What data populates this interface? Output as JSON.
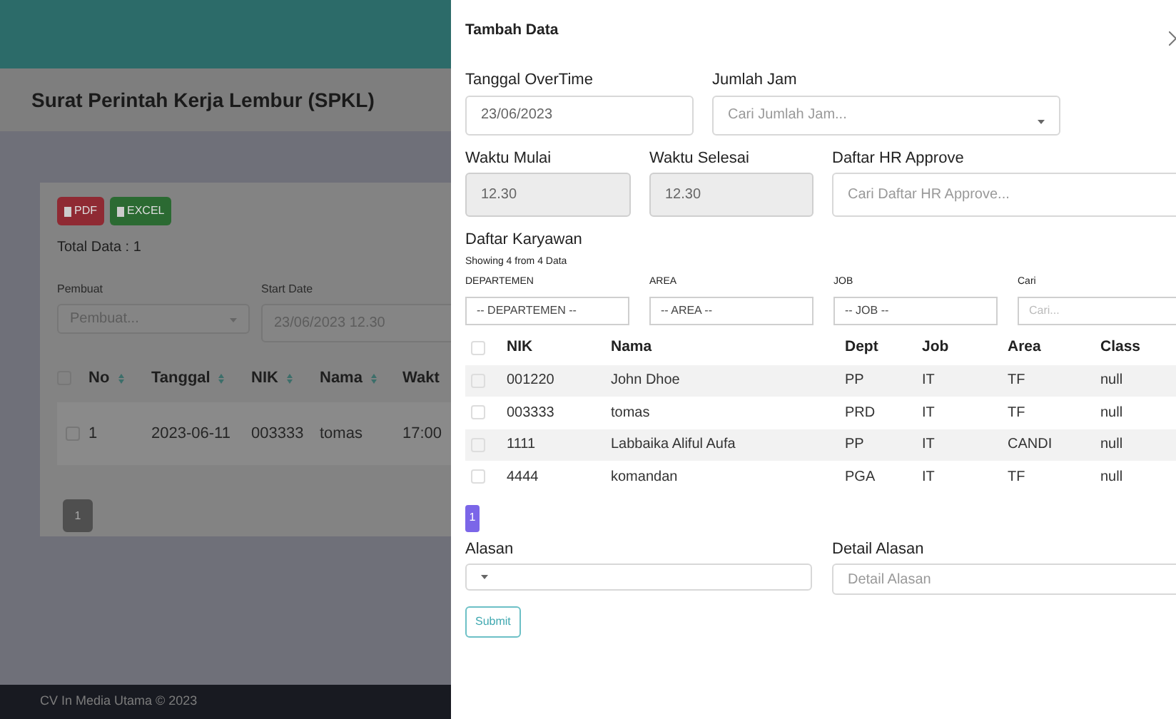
{
  "page": {
    "title": "Surat Perintah Kerja Lembur (SPKL)",
    "export_buttons": [
      {
        "label": "PDF",
        "kind": "pdf"
      },
      {
        "label": "EXCEL",
        "kind": "excel"
      }
    ],
    "total": "Total Data : 1",
    "filters": [
      {
        "label": "Pembuat",
        "placeholder": "Pembuat...",
        "kind": "select"
      },
      {
        "label": "Start Date",
        "value": "23/06/2023 12.30",
        "kind": "date"
      }
    ],
    "table": {
      "select_all_checked": false,
      "columns": [
        "No",
        "Tanggal",
        "NIK",
        "Nama",
        "Wakt"
      ],
      "rows": [
        {
          "checked": false,
          "cells": [
            "1",
            "2023-06-11",
            "003333",
            "tomas",
            "17:00"
          ]
        }
      ]
    },
    "pagination": [
      {
        "label": "1",
        "selected": true
      }
    ],
    "footer": "CV In Media Utama © 2023"
  },
  "panel": {
    "title": "Tambah Data",
    "fields_row_1": [
      {
        "label": "Tanggal OverTime",
        "value": "23/06/2023",
        "kind": "date"
      },
      {
        "label": "Jumlah Jam",
        "placeholder": "Cari Jumlah Jam...",
        "kind": "select"
      }
    ],
    "fields_row_2": [
      {
        "label": "Waktu Mulai",
        "value": "12.30",
        "kind": "time",
        "disabled": true
      },
      {
        "label": "Waktu Selesai",
        "value": "12.30",
        "kind": "time",
        "disabled": true
      },
      {
        "label": "Daftar HR Approve",
        "placeholder": "Cari Daftar HR Approve...",
        "kind": "select"
      }
    ],
    "employees": {
      "title": "Daftar Karyawan",
      "info": "Showing 4 from 4 Data",
      "filters": [
        {
          "label": "DEPARTEMEN",
          "value": "-- DEPARTEMEN --",
          "kind": "select"
        },
        {
          "label": "AREA",
          "value": "-- AREA --",
          "kind": "select"
        },
        {
          "label": "JOB",
          "value": "-- JOB --",
          "kind": "select"
        },
        {
          "label": "Cari",
          "placeholder": "Cari...",
          "kind": "input"
        }
      ],
      "select_all_checked": false,
      "columns": [
        "NIK",
        "Nama",
        "Dept",
        "Job",
        "Area",
        "Class"
      ],
      "rows": [
        {
          "checked": false,
          "cells": [
            "001220",
            "John Dhoe",
            "PP",
            "IT",
            "TF",
            "null"
          ]
        },
        {
          "checked": false,
          "cells": [
            "003333",
            "tomas",
            "PRD",
            "IT",
            "TF",
            "null"
          ]
        },
        {
          "checked": false,
          "cells": [
            "1111",
            "Labbaika Aliful Aufa",
            "PP",
            "IT",
            "CANDI",
            "null"
          ]
        },
        {
          "checked": false,
          "cells": [
            "4444",
            "komandan",
            "PGA",
            "IT",
            "TF",
            "null"
          ]
        }
      ],
      "pagination": [
        {
          "label": "1",
          "selected": true
        }
      ]
    },
    "fields_row_3": [
      {
        "label": "Alasan",
        "kind": "select"
      },
      {
        "label": "Detail Alasan",
        "placeholder": "Detail Alasan",
        "kind": "input"
      }
    ],
    "submit": "Submit"
  }
}
